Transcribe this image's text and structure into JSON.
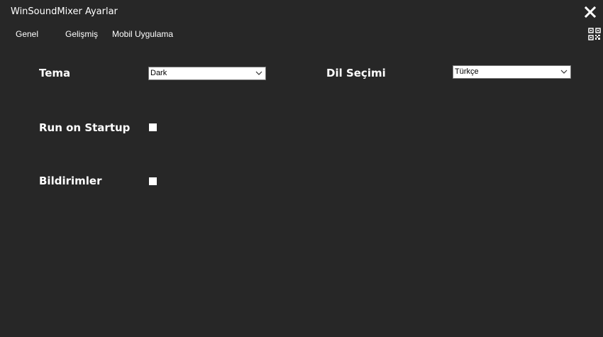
{
  "window": {
    "title": "WinSoundMixer Ayarlar",
    "background_color": "#272727",
    "close_icon": "close-icon",
    "qr_icon": "qr-code-icon"
  },
  "tabs": [
    {
      "label": "Genel"
    },
    {
      "label": "Gelişmiş"
    },
    {
      "label": "Mobil Uygulama"
    }
  ],
  "settings": {
    "theme": {
      "label": "Tema",
      "selected": "Dark"
    },
    "language": {
      "label": "Dil Seçimi",
      "selected": "Türkçe"
    },
    "startup": {
      "label": "Run on Startup",
      "checked": false
    },
    "notifications": {
      "label": "Bildirimler",
      "checked": false
    }
  }
}
